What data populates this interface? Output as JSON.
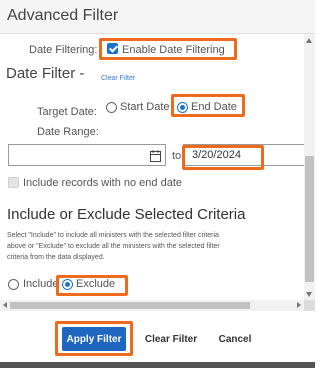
{
  "dialog": {
    "title": "Advanced Filter"
  },
  "date_filtering": {
    "label": "Date Filtering:",
    "checkbox_label": "Enable Date Filtering",
    "checked": true
  },
  "date_filter_section": {
    "heading": "Date Filter -",
    "clear_link": "Clear Filter",
    "target_date_label": "Target Date:",
    "target_options": [
      {
        "label": "Start Date",
        "selected": false
      },
      {
        "label": "End Date",
        "selected": true
      }
    ],
    "date_range_label": "Date Range:",
    "start_date_value": "",
    "range_separator": "to",
    "end_date_value": "3/20/2024",
    "no_end_date_label": "Include records with no end date",
    "no_end_date_checked": false
  },
  "criteria_section": {
    "heading": "Include or Exclude Selected Criteria",
    "description_line1": "Select \"Include\" to include all ministers with the selected filter criteria",
    "description_line2": "above or \"Exclude\" to exclude all the ministers with the selected filter",
    "description_line3": "criteria from the data displayed.",
    "options": [
      {
        "label": "Include",
        "selected": false
      },
      {
        "label": "Exclude",
        "selected": true
      }
    ]
  },
  "footer": {
    "apply_label": "Apply Filter",
    "clear_label": "Clear Filter",
    "cancel_label": "Cancel"
  },
  "colors": {
    "accent": "#1f66c1",
    "highlight": "#f06a1e",
    "link": "#3a7bd5"
  },
  "icons": [
    "calendar-icon"
  ]
}
